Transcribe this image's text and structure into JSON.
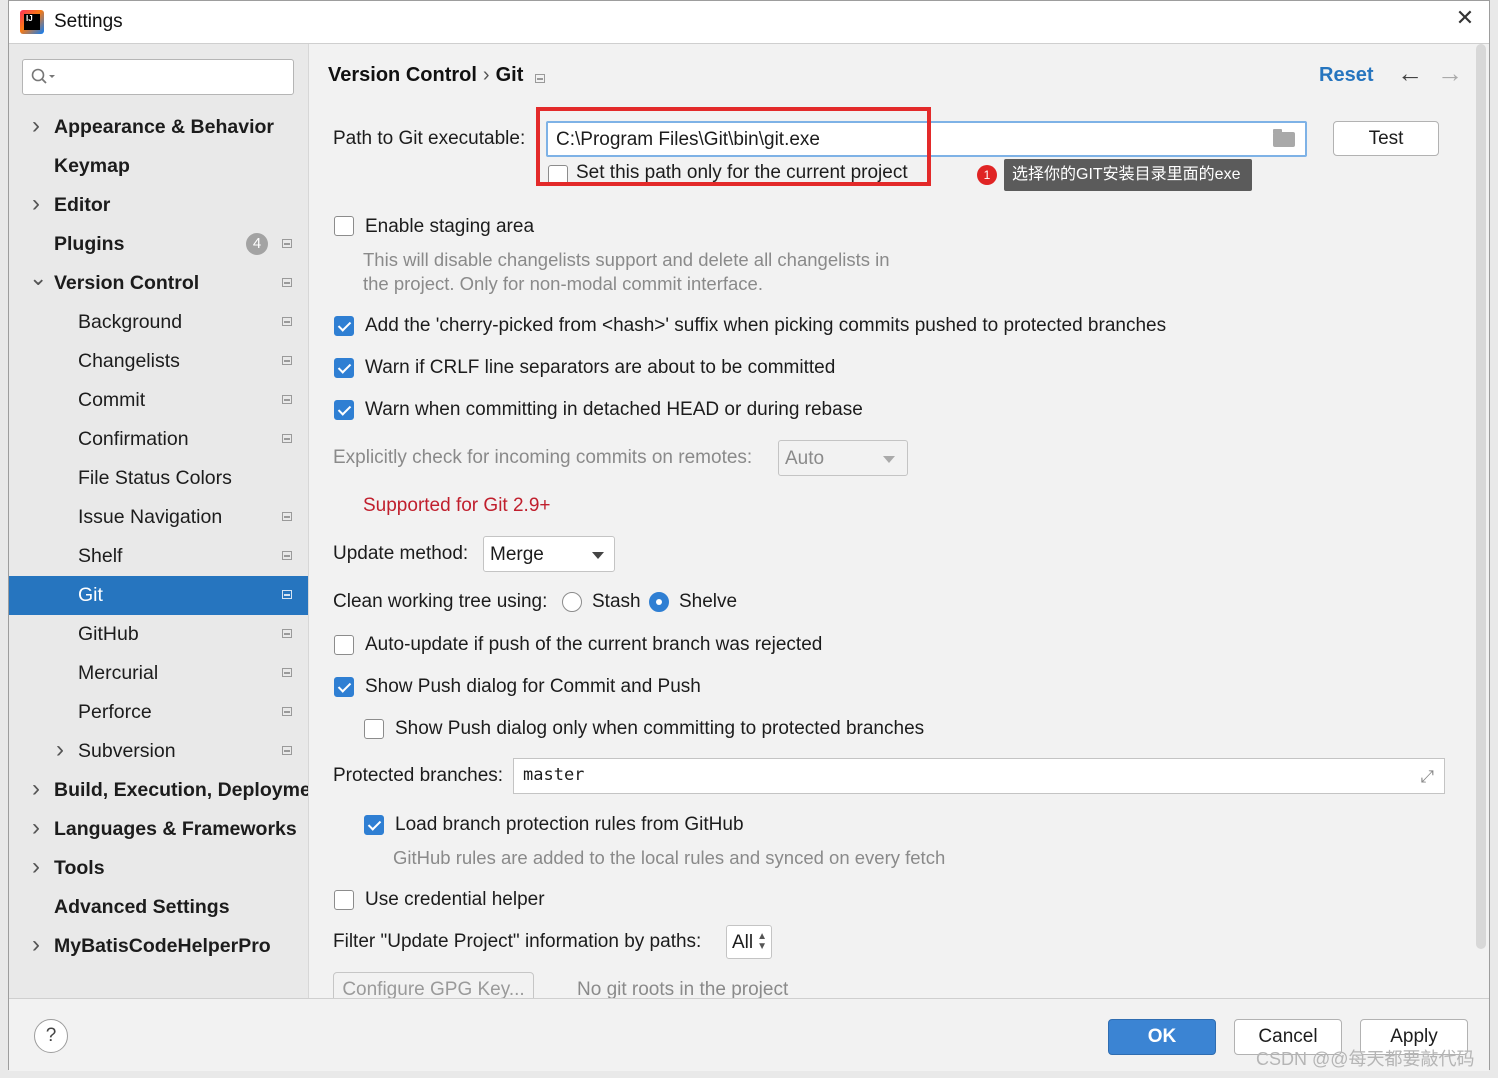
{
  "window": {
    "title": "Settings",
    "app_icon_text": "IJ"
  },
  "search": {
    "placeholder": ""
  },
  "sidebar": {
    "items": [
      {
        "label": "Appearance & Behavior",
        "level": 0,
        "expand": "collapsed"
      },
      {
        "label": "Keymap",
        "level": 0,
        "expand": "none"
      },
      {
        "label": "Editor",
        "level": 0,
        "expand": "collapsed"
      },
      {
        "label": "Plugins",
        "level": 0,
        "expand": "none",
        "badge": "4"
      },
      {
        "label": "Version Control",
        "level": 0,
        "expand": "expanded"
      },
      {
        "label": "Background",
        "level": 1
      },
      {
        "label": "Changelists",
        "level": 1
      },
      {
        "label": "Commit",
        "level": 1
      },
      {
        "label": "Confirmation",
        "level": 1
      },
      {
        "label": "File Status Colors",
        "level": 1
      },
      {
        "label": "Issue Navigation",
        "level": 1
      },
      {
        "label": "Shelf",
        "level": 1
      },
      {
        "label": "Git",
        "level": 1,
        "selected": true
      },
      {
        "label": "GitHub",
        "level": 1
      },
      {
        "label": "Mercurial",
        "level": 1
      },
      {
        "label": "Perforce",
        "level": 1
      },
      {
        "label": "Subversion",
        "level": 1,
        "expand": "collapsed"
      },
      {
        "label": "Build, Execution, Deployment",
        "level": 0,
        "expand": "collapsed"
      },
      {
        "label": "Languages & Frameworks",
        "level": 0,
        "expand": "collapsed"
      },
      {
        "label": "Tools",
        "level": 0,
        "expand": "collapsed"
      },
      {
        "label": "Advanced Settings",
        "level": 0,
        "expand": "none"
      },
      {
        "label": "MyBatisCodeHelperPro",
        "level": 0,
        "expand": "collapsed"
      }
    ]
  },
  "breadcrumb": {
    "parent": "Version Control",
    "separator": "›",
    "current": "Git"
  },
  "header": {
    "reset": "Reset",
    "back": "←",
    "forward": "→"
  },
  "git_path": {
    "label": "Path to Git executable:",
    "value": "C:\\Program Files\\Git\\bin\\git.exe",
    "test_button": "Test",
    "current_project_only": "Set this path only for the current project",
    "current_project_only_checked": false
  },
  "annotation": {
    "number": "1",
    "text": "选择你的GIT安装目录里面的exe"
  },
  "options": {
    "staging_area": {
      "label": "Enable staging area",
      "checked": false,
      "hint_line1": "This will disable changelists support and delete all changelists in",
      "hint_line2": "the project. Only for non-modal commit interface."
    },
    "cherry_pick": {
      "label": "Add the 'cherry-picked from <hash>' suffix when picking commits pushed to protected branches",
      "checked": true
    },
    "crlf": {
      "label": "Warn if CRLF line separators are about to be committed",
      "checked": true
    },
    "detached_head": {
      "label": "Warn when committing in detached HEAD or during rebase",
      "checked": true
    },
    "incoming": {
      "label": "Explicitly check for incoming commits on remotes:",
      "value": "Auto",
      "note": "Supported for Git 2.9+"
    },
    "update_method": {
      "label": "Update method:",
      "value": "Merge"
    },
    "clean_tree": {
      "label": "Clean working tree using:",
      "option1": "Stash",
      "option2": "Shelve",
      "selected": "Shelve"
    },
    "auto_update": {
      "label": "Auto-update if push of the current branch was rejected",
      "checked": false
    },
    "show_push": {
      "label": "Show Push dialog for Commit and Push",
      "checked": true
    },
    "show_push_protected": {
      "label": "Show Push dialog only when committing to protected branches",
      "checked": false
    },
    "protected_branches": {
      "label": "Protected branches:",
      "value": "master"
    },
    "load_rules": {
      "label": "Load branch protection rules from GitHub",
      "checked": true,
      "hint": "GitHub rules are added to the local rules and synced on every fetch"
    },
    "credential_helper": {
      "label": "Use credential helper",
      "checked": false
    },
    "filter_paths": {
      "label": "Filter \"Update Project\" information by paths:",
      "value": "All"
    },
    "gpg": {
      "button": "Configure GPG Key...",
      "note": "No git roots in the project"
    }
  },
  "footer": {
    "help": "?",
    "ok": "OK",
    "cancel": "Cancel",
    "apply": "Apply"
  },
  "watermark": "CSDN @@每天都要敲代码",
  "colors": {
    "accent": "#2675bf",
    "checkbox": "#2f7fd3",
    "note_red": "#c01f2d",
    "highlight_box": "#e32a2a"
  }
}
